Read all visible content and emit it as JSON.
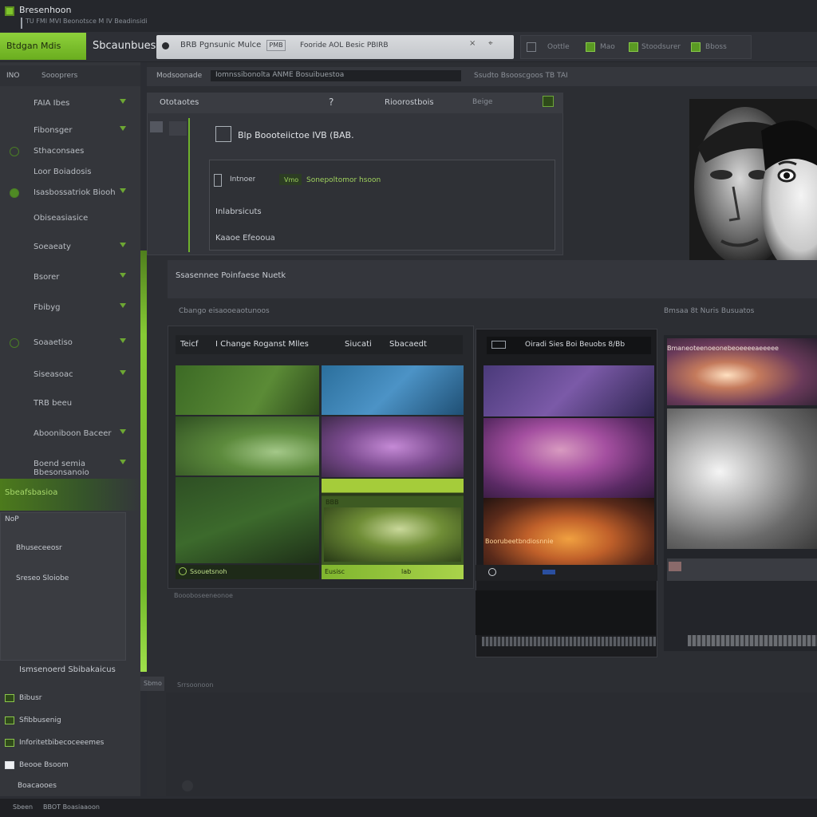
{
  "app": {
    "title": "Bresenhoon",
    "subtitle": "TU FMI MVI Beonotsce M IV Beadinsidi"
  },
  "toolbar": {
    "brand_tab": "Btdgan Mdis",
    "section_title": "Sbcaunbues",
    "search": {
      "text": "BRB Pgnsunic Mulce",
      "badge": "PMB",
      "text2": "Fooride AOL Besic  PBIRB"
    },
    "right_labels": [
      "Oottle",
      "Mao",
      "Stoodsurer",
      "Bboss"
    ]
  },
  "sidebar": {
    "header_left": "INO",
    "header_right": "Soooprers",
    "items": [
      {
        "label": "FAIA Ibes"
      },
      {
        "label": "Fibonsger"
      },
      {
        "label": "Sthaconsaes"
      },
      {
        "label": "Loor Boiadosis"
      },
      {
        "label": "Isasbossatriok Biooh"
      },
      {
        "label": "Obiseasiasice"
      },
      {
        "label": "Soeaeaty"
      },
      {
        "label": "Bsorer"
      },
      {
        "label": "Fbibyg"
      },
      {
        "label": "Soaaetiso"
      },
      {
        "label": "Siseasoac"
      },
      {
        "label": "TRB beeu"
      },
      {
        "label": "Abooniboon Baceer"
      },
      {
        "label": "Boend semia Bbesonsanoio"
      }
    ],
    "active_section": "Sbeafsbasioa",
    "panel_items": [
      "NoP",
      "Bhuseceeosr",
      "Sreseo Sloiobe"
    ],
    "bottom_label": "Ismsenoerd Sbibakaicus",
    "bottom_items": [
      {
        "label": "Bibusr"
      },
      {
        "label": "Sfibbusenig"
      },
      {
        "label": "Inforitetbibecoceeemes"
      },
      {
        "label": "Beooe Bsoom"
      },
      {
        "label": "Boacaooes"
      }
    ]
  },
  "main": {
    "header_left": "Modsoonade",
    "header_bar": "Iomnssibonolta ANME Bosuibuestoa",
    "header_right": "Ssudto Bsooscgoos TB TAI",
    "props": {
      "title": "Ototaotes",
      "icon": "?",
      "title2": "Rioorostbois",
      "title3": "Beige",
      "row1": "Blp Boooteiictoe IVB (BAB.",
      "row2a": "Intnoer",
      "row2b": "Vmo",
      "row2c": "Sonepoltomor hsoon",
      "row3": "Inlabrsicuts",
      "row4": "Kaaoe Efeooua"
    },
    "section_bar": "Ssasennee Poinfaese Nuetk",
    "gallery_left_label": "Cbango eisaooeaotunoos",
    "gallery_right_label": "Bmsaa 8t Nuris Busuatos",
    "pane_a": {
      "head1": "Teicf",
      "head1b": "I Change Roganst Mlles",
      "head2": "Siucati",
      "head3": "Sbacaedt",
      "yellow_label": "BBB",
      "foot_left": "Ssouetsnoh",
      "foot_right": "Eusisc",
      "foot_right_b": "lab",
      "caption": "Boooboseeneonoe"
    },
    "pane_b": {
      "head": "Oiradi Sies Boi Beuobs 8/Bb",
      "label": "Boorubeetbndiosnnie"
    },
    "pane_c": {
      "head": "Bmaneoteenoeonebeoeeeeaeeeee"
    },
    "foot_label": "Srrsoonoon",
    "foot_left": "Sbmo"
  },
  "status": {
    "left": "Sbeen",
    "right": "BBOT  Boasiaaoon"
  },
  "colors": {
    "accent": "#8ed13b",
    "accent_dark": "#5c8d20",
    "background": "#2b2d33",
    "sidebar": "#34363b"
  }
}
